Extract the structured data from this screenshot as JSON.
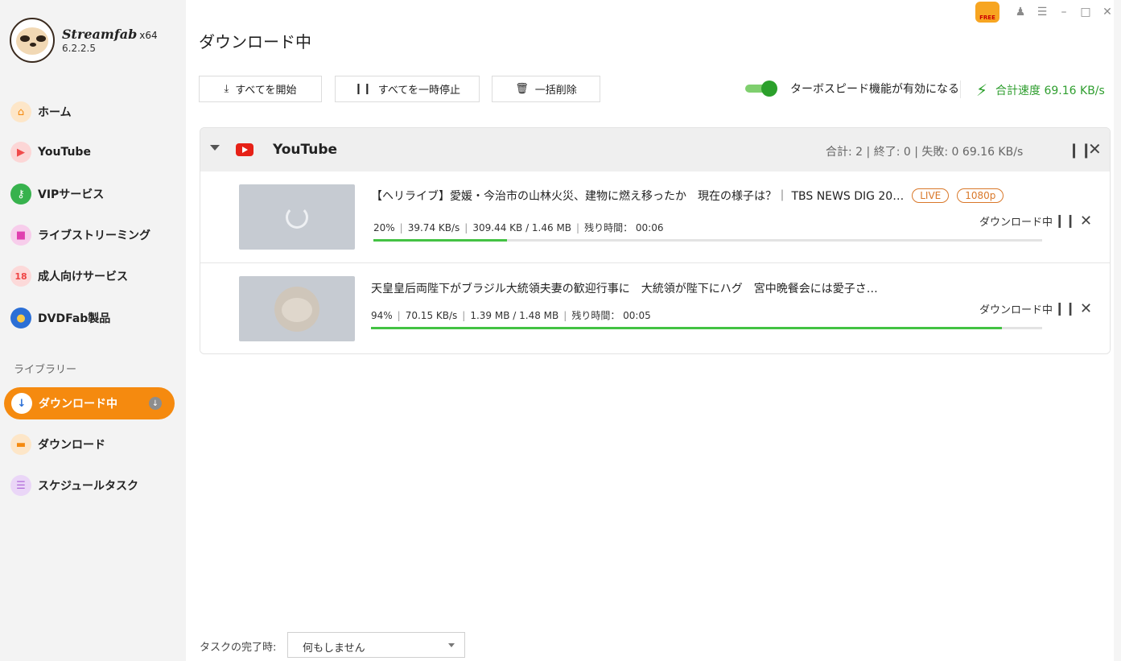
{
  "app": {
    "name": "Streamfab",
    "arch": "x64",
    "version": "6.2.2.5",
    "free_badge": "FREE"
  },
  "sidebar": {
    "items": [
      {
        "label": "ホーム",
        "icon": "home-icon",
        "color": "#f58a0f"
      },
      {
        "label": "YouTube",
        "icon": "youtube-icon",
        "color": "#f04b4b"
      },
      {
        "label": "VIPサービス",
        "icon": "key-icon",
        "color": "#37b24d"
      },
      {
        "label": "ライブストリーミング",
        "icon": "video-camera-icon",
        "color": "#e040b0"
      },
      {
        "label": "成人向けサービス",
        "icon": "adult-18-icon",
        "color": "#ef4444"
      },
      {
        "label": "DVDFab製品",
        "icon": "dvdfab-icon",
        "color": "#2b6fd6"
      }
    ],
    "library_title": "ライブラリー",
    "library": [
      {
        "label": "ダウンロード中",
        "icon": "download-arrow-icon",
        "active": true
      },
      {
        "label": "ダウンロード",
        "icon": "folder-icon",
        "color": "#f58a0f"
      },
      {
        "label": "スケジュールタスク",
        "icon": "schedule-icon",
        "color": "#b06ad9"
      }
    ]
  },
  "header": {
    "title": "ダウンロード中"
  },
  "toolbar": {
    "start_all": "すべてを開始",
    "pause_all": "すべてを一時停止",
    "delete_all": "一括削除",
    "turbo_label": "ターボスピード機能が有効になる",
    "turbo_enabled": true,
    "total_speed": "合計速度 69.16 KB/s"
  },
  "group": {
    "name": "YouTube",
    "stats": "合計: 2 | 終了: 0 | 失敗: 0   69.16 KB/s"
  },
  "tasks": [
    {
      "title": "【ヘリライブ】愛媛・今治市の山林火災、建物に燃え移ったか　現在の様子は？｜ TBS NEWS DIG 20…",
      "tags": [
        "LIVE",
        "1080p"
      ],
      "percent": "20%",
      "speed": "39.74 KB/s",
      "size": "309.44 KB / 1.46 MB",
      "remaining": "残り時間： 00:06",
      "progress": 0.2,
      "status": "ダウンロード中"
    },
    {
      "title": "天皇皇后両陛下がブラジル大統領夫妻の歓迎行事に　大統領が陛下にハグ　宮中晩餐会には愛子さ…",
      "tags": [],
      "percent": "94%",
      "speed": "70.15 KB/s",
      "size": "1.39 MB / 1.48 MB",
      "remaining": "残り時間： 00:05",
      "progress": 0.94,
      "status": "ダウンロード中"
    }
  ],
  "footer": {
    "completion_label": "タスクの完了時:",
    "completion_value": "何もしません"
  },
  "colors": {
    "accent": "#f58a0f",
    "progress": "#43c243",
    "speed": "#2f9e2f",
    "tag": "#d9782a"
  }
}
